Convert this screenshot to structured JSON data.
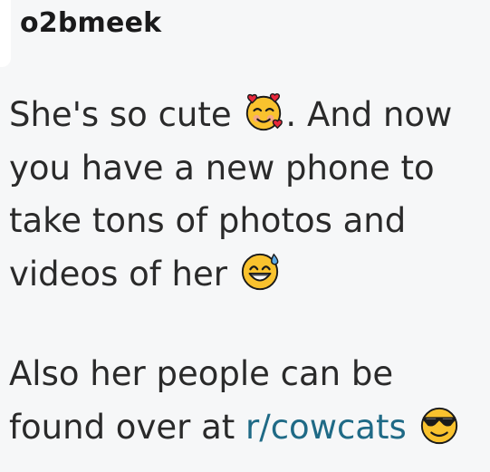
{
  "comment": {
    "author": "o2bmeek",
    "paragraph1": {
      "text_before_emoji1": "She's so cute ",
      "emoji1": "smiling-face-with-hearts-icon",
      "text_after_emoji1": ". And now you have a new phone to take tons of photos and videos of her ",
      "emoji2": "grinning-face-with-sweat-icon"
    },
    "paragraph2": {
      "text_before_link": "Also her people can be found over at ",
      "link_text": "r/cowcats",
      "emoji3": "smiling-face-with-sunglasses-icon"
    }
  },
  "colors": {
    "background": "#f6f7f8",
    "text": "#2a2a2a",
    "link": "#1f6a86"
  }
}
